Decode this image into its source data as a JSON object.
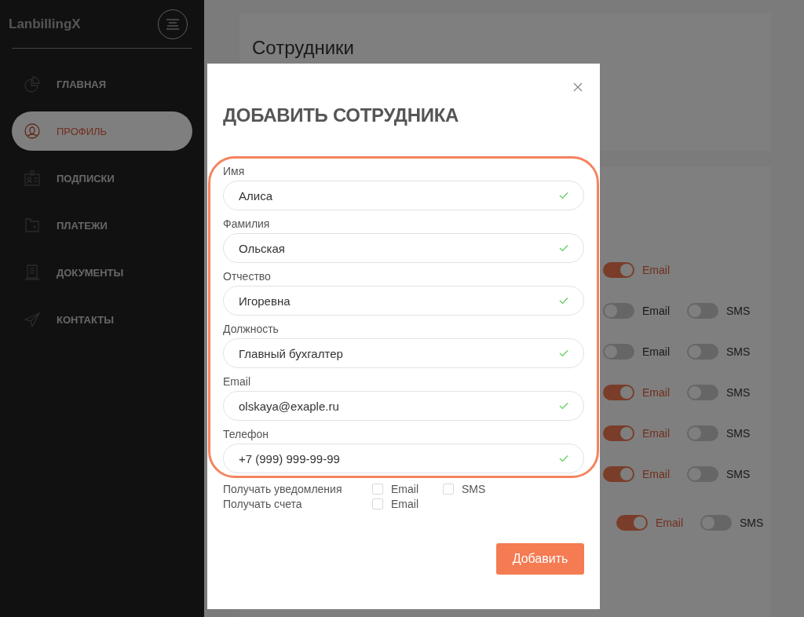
{
  "sidebar": {
    "logo": "LanbillingX",
    "items": [
      {
        "label": "ГЛАВНАЯ",
        "selected": false
      },
      {
        "label": "ПРОФИЛЬ",
        "selected": true
      },
      {
        "label": "ПОДПИСКИ",
        "selected": false
      },
      {
        "label": "ПЛАТЕЖИ",
        "selected": false
      },
      {
        "label": "ДОКУМЕНТЫ",
        "selected": false
      },
      {
        "label": "КОНТАКТЫ",
        "selected": false
      }
    ]
  },
  "page": {
    "title": "Сотрудники",
    "toggle_rows": [
      {
        "toggles": [
          {
            "label": "Email",
            "on": true
          }
        ]
      },
      {
        "toggles": [
          {
            "label": "Email",
            "on": false
          },
          {
            "label": "SMS",
            "on": false
          }
        ]
      },
      {
        "toggles": [
          {
            "label": "Email",
            "on": false
          },
          {
            "label": "SMS",
            "on": false
          }
        ]
      },
      {
        "toggles": [
          {
            "label": "Email",
            "on": true
          },
          {
            "label": "SMS",
            "on": false
          }
        ]
      },
      {
        "toggles": [
          {
            "label": "Email",
            "on": true
          },
          {
            "label": "SMS",
            "on": false
          }
        ]
      },
      {
        "toggles": [
          {
            "label": "Email",
            "on": true
          },
          {
            "label": "SMS",
            "on": false
          }
        ]
      },
      {
        "toggles": [
          {
            "label": "Email",
            "on": true
          },
          {
            "label": "SMS",
            "on": false
          }
        ]
      }
    ]
  },
  "dialog": {
    "title": "ДОБАВИТЬ СОТРУДНИКА",
    "fields": [
      {
        "label": "Имя",
        "value": "Алиса",
        "valid": true
      },
      {
        "label": "Фамилия",
        "value": "Ольская",
        "valid": true
      },
      {
        "label": "Отчество",
        "value": "Игоревна",
        "valid": true
      },
      {
        "label": "Должность",
        "value": "Главный бухгалтер",
        "valid": true
      },
      {
        "label": "Email",
        "value": "olskaya@exaple.ru",
        "valid": true
      },
      {
        "label": "Телефон",
        "value": "+7 (999) 999-99-99",
        "valid": true
      }
    ],
    "options": [
      {
        "label": "Получать уведомления",
        "checkboxes": [
          {
            "label": "Email",
            "checked": false
          },
          {
            "label": "SMS",
            "checked": false
          }
        ]
      },
      {
        "label": "Получать счета",
        "checkboxes": [
          {
            "label": "Email",
            "checked": false
          }
        ]
      }
    ],
    "submit": "Добавить"
  }
}
